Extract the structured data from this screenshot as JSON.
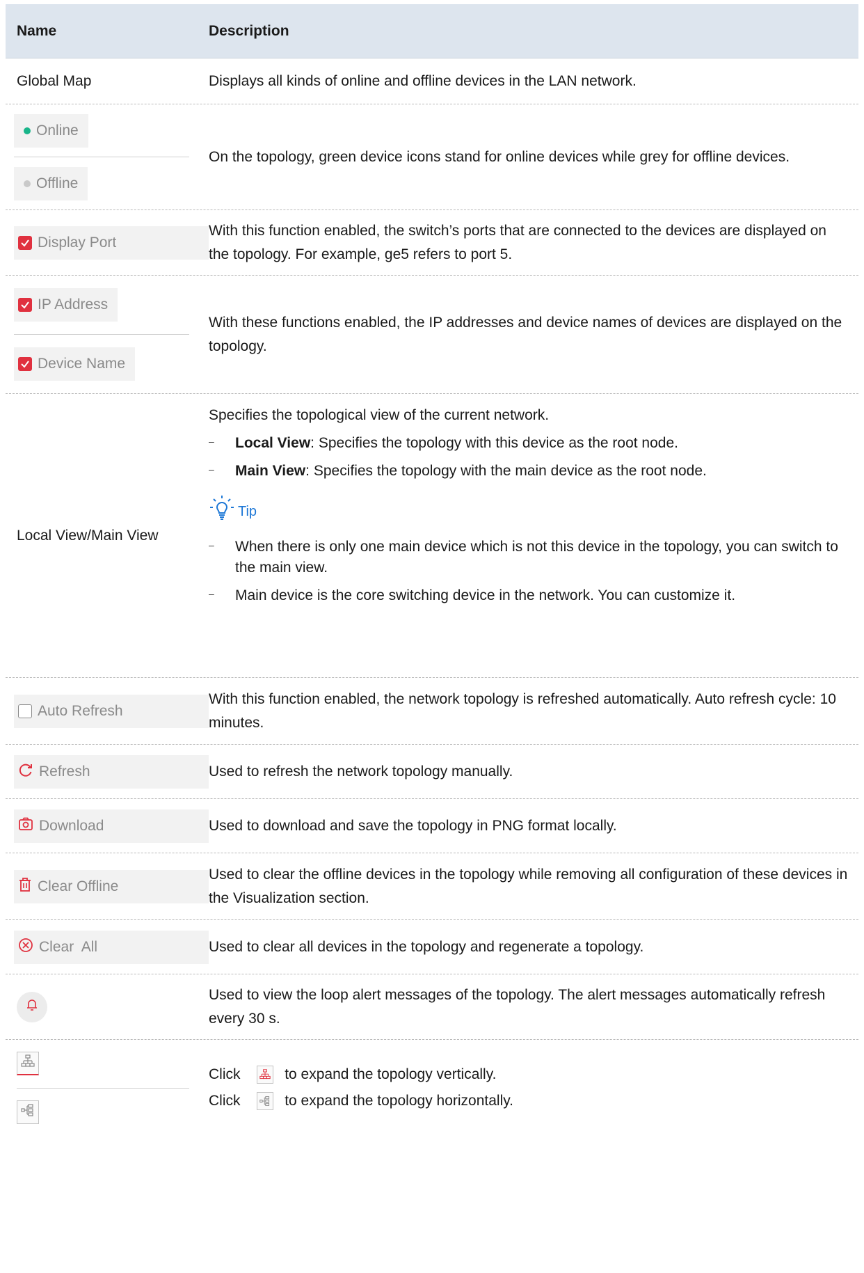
{
  "header": {
    "name": "Name",
    "description": "Description"
  },
  "rows": {
    "global_map": {
      "name": "Global Map",
      "desc": "Displays all kinds of online and offline devices in the LAN network."
    },
    "status": {
      "online_label": "Online",
      "offline_label": "Offline",
      "desc": "On the topology, green device icons stand for online devices while grey for offline devices."
    },
    "display_port": {
      "label": "Display Port",
      "desc": "With this function enabled, the switch’s ports that are connected to the devices are displayed on the topology. For example, ge5 refers to port 5."
    },
    "ip_device": {
      "ip_label": "IP Address",
      "device_label": "Device Name",
      "desc": "With these functions enabled, the IP addresses and device names of devices are displayed on the topology."
    },
    "view": {
      "name": "Local View/Main View",
      "intro": "Specifies the topological view of the current network.",
      "local_term": "Local View",
      "local_desc": ": Specifies the topology with this device as the root node.",
      "main_term": "Main View",
      "main_desc": ": Specifies the topology with the main device as the root node.",
      "tip_label": "Tip",
      "tip1": "When there is only one main device which is not this device in the topology, you can switch to the main view.",
      "tip2": "Main device is the core switching device in the network. You can customize it."
    },
    "auto_refresh": {
      "label": "Auto Refresh",
      "desc": "With this function enabled, the network topology is refreshed automatically. Auto refresh cycle: 10 minutes."
    },
    "refresh": {
      "label": "Refresh",
      "desc": "Used to refresh the network topology manually."
    },
    "download": {
      "label": "Download",
      "desc": "Used to download and save the topology in PNG format locally."
    },
    "clear_offline": {
      "label": "Clear Offline",
      "desc": "Used to clear the offline devices in the topology while removing all configuration of these devices in the Visualization section."
    },
    "clear_all": {
      "label": "Clear  All",
      "desc": "Used to clear all devices in the topology and regenerate a topology."
    },
    "alert": {
      "desc": "Used to view the loop alert messages of the topology. The alert messages automatically refresh every 30 s."
    },
    "expand": {
      "click1": "Click",
      "vertical_desc": "to expand the topology vertically.",
      "click2": "Click",
      "horizontal_desc": "to expand the topology horizontally."
    }
  },
  "colors": {
    "header_bg": "#dde5ee",
    "online": "#19b58a",
    "offline": "#c9c9c9",
    "accent_red": "#e0313f",
    "tip_blue": "#1c77d6"
  },
  "icons": [
    "checkbox-checked-icon",
    "checkbox-unchecked-icon",
    "refresh-icon",
    "camera-icon",
    "trash-icon",
    "circle-x-icon",
    "bell-icon",
    "lightbulb-icon",
    "vertical-topology-icon",
    "horizontal-topology-icon"
  ]
}
